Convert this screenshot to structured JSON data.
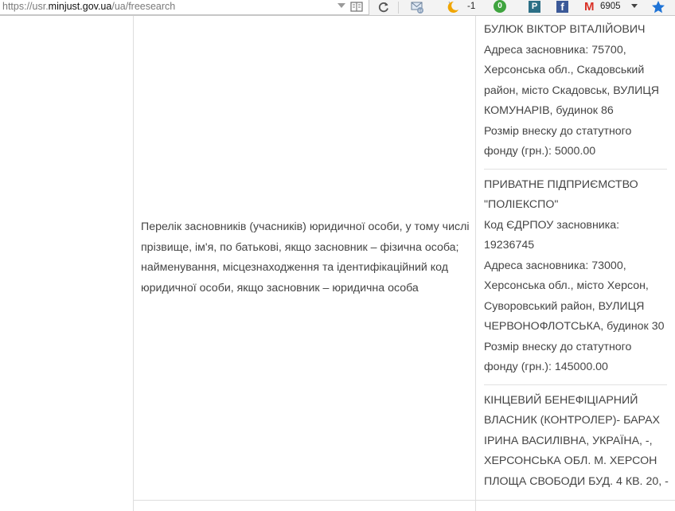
{
  "browser": {
    "url_prefix": "https://usr.",
    "url_host": "minjust.gov.ua",
    "url_path": "/ua/freesearch",
    "moon_count": "-1",
    "green_badge": "0",
    "p_label": "P",
    "fb_label": "f",
    "gmail_label": "M",
    "gmail_count": "6905"
  },
  "row": {
    "label": "Перелік засновників (учасників) юридичної особи, у тому числі прізвище, ім'я, по батькові, якщо засновник – фізична особа; найменування, місцезнаходження та ідентифікаційний код юридичної особи, якщо засновник – юридична особа",
    "entries": [
      {
        "lines": [
          "БУЛЮК ВІКТОР ВІТАЛІЙОВИЧ",
          "Адреса засновника: 75700,",
          "Херсонська обл., Скадовський",
          "район, місто Скадовськ, ВУЛИЦЯ",
          "КОМУНАРІВ, будинок 86",
          "Розмір внеску до статутного",
          "фонду (грн.): 5000.00"
        ]
      },
      {
        "lines": [
          "ПРИВАТНЕ ПІДПРИЄМСТВО",
          "\"ПОЛІЕКСПО\"",
          "Код ЄДРПОУ засновника:",
          "19236745",
          "Адреса засновника: 73000,",
          "Херсонська обл., місто Херсон,",
          "Суворовський район, ВУЛИЦЯ",
          "ЧЕРВОНОФЛОТСЬКА, будинок 30",
          "Розмір внеску до статутного",
          "фонду (грн.): 145000.00"
        ]
      },
      {
        "lines": [
          "КІНЦЕВИЙ БЕНЕФІЦІАРНИЙ",
          "ВЛАСНИК (КОНТРОЛЕР)- БАРАХ",
          "ІРИНА ВАСИЛІВНА, УКРАЇНА, -,",
          "ХЕРСОНСЬКА ОБЛ. М. ХЕРСОН",
          "ПЛОЩА СВОБОДИ БУД. 4 КВ. 20, -"
        ]
      }
    ]
  },
  "colors": {
    "text": "#444444",
    "border": "#dedede",
    "toolbar_bg": "#f3f3f3"
  }
}
